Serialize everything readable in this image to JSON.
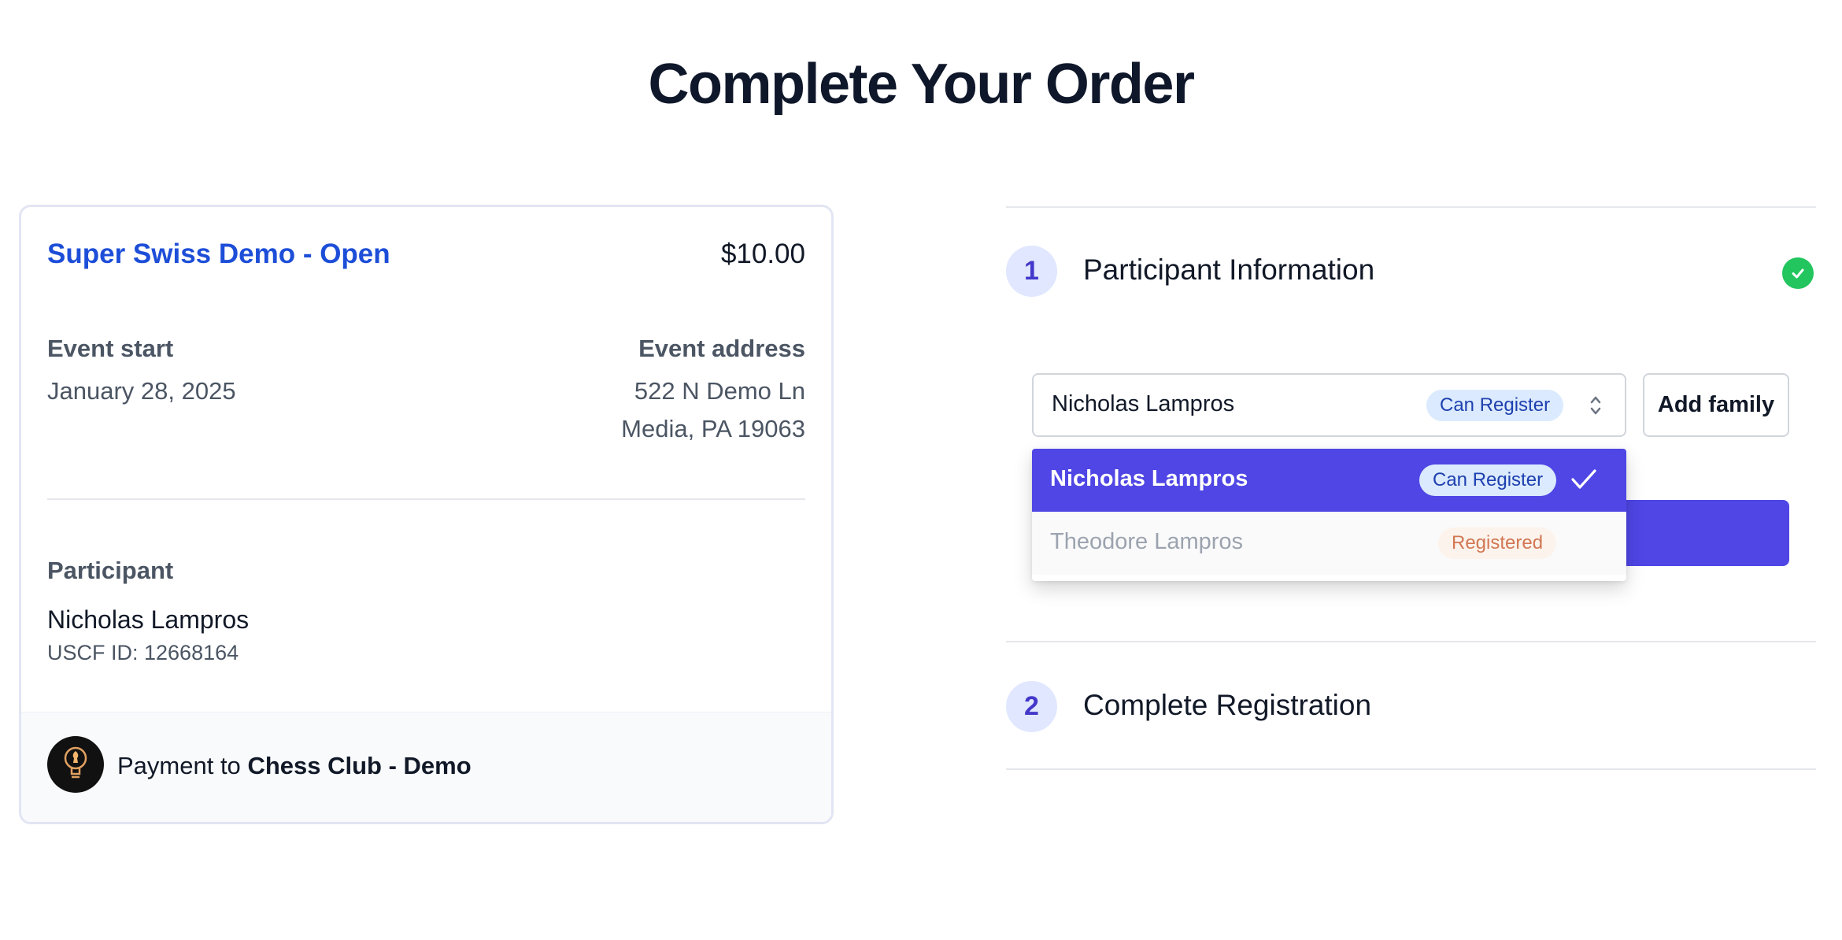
{
  "page": {
    "title": "Complete Your Order"
  },
  "order": {
    "event_name": "Super Swiss Demo - Open",
    "price": "$10.00",
    "event_start_label": "Event start",
    "event_start": "January 28, 2025",
    "event_address_label": "Event address",
    "address_line1": "522 N Demo Ln",
    "address_line2": "Media, PA 19063",
    "participant_label": "Participant",
    "participant_name": "Nicholas Lampros",
    "uscf_id": "USCF ID: 12668164",
    "payment_prefix": "Payment to",
    "payment_to": "Chess Club - Demo"
  },
  "steps": [
    {
      "number": "1",
      "title": "Participant Information",
      "completed": true
    },
    {
      "number": "2",
      "title": "Complete Registration",
      "completed": false
    }
  ],
  "participant_select": {
    "selected": "Nicholas Lampros",
    "selected_badge": "Can Register",
    "add_family_label": "Add family",
    "options": [
      {
        "name": "Nicholas Lampros",
        "badge": "Can Register",
        "selected": true
      },
      {
        "name": "Theodore Lampros",
        "badge": "Registered",
        "selected": false
      }
    ]
  },
  "colors": {
    "accent": "#4f46e5",
    "link": "#1d4ed8",
    "success": "#22c55e",
    "badge_can_bg": "#dbeafe",
    "badge_registered_bg": "#fdf1e7"
  },
  "icons": {
    "select": "chevron-up-down-icon",
    "selected_option": "checkmark-icon",
    "step_done": "check-circle-icon",
    "club_logo": "lightbulb-chess-logo"
  }
}
